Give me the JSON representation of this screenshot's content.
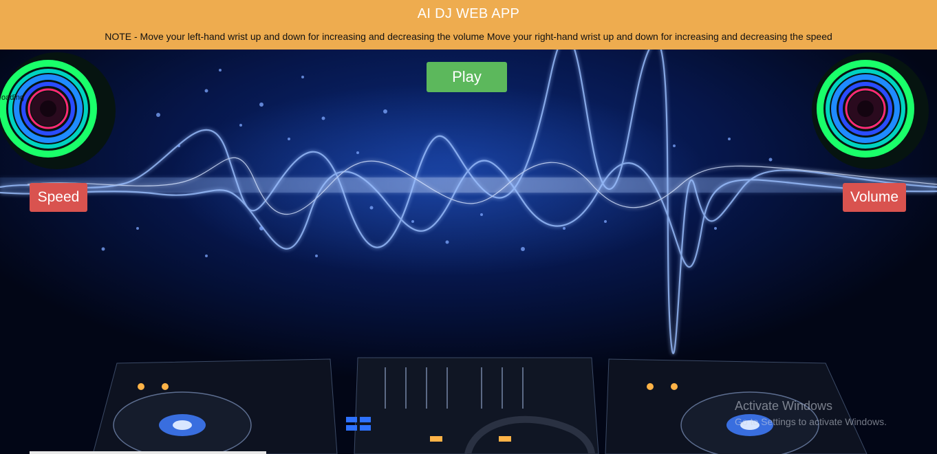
{
  "header": {
    "title": "AI DJ WEB APP",
    "note": "NOTE - Move your left-hand wrist up and down for increasing and decreasing the volume Move your right-hand wrist up and down for increasing and decreasing the speed"
  },
  "controls": {
    "play_label": "Play",
    "speed_label": "Speed",
    "volume_label": "Volume"
  },
  "status": {
    "loading_text": "oading"
  },
  "watermark": {
    "title": "Activate Windows",
    "subtitle": "Go to Settings to activate Windows."
  },
  "colors": {
    "header_bg": "#eeac4f",
    "play_button": "#5cb85c",
    "speed_volume_buttons": "#d9534f"
  }
}
